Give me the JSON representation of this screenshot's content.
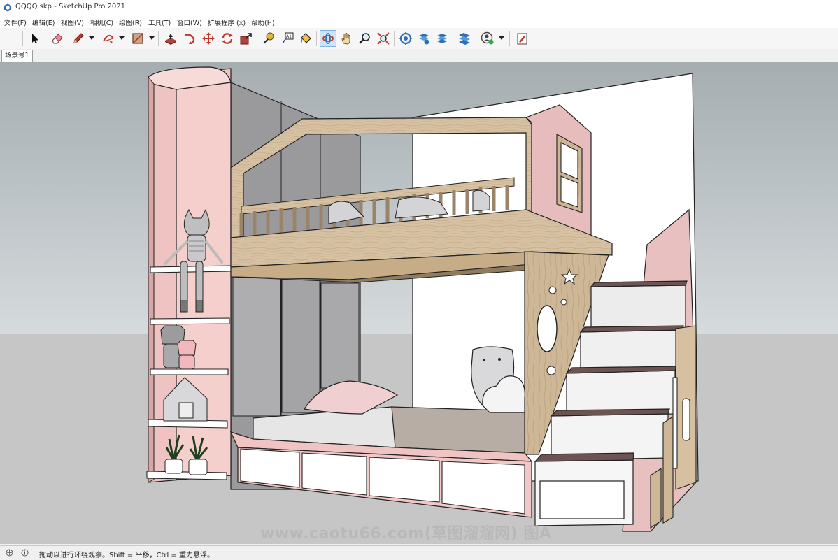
{
  "window": {
    "title": "QQQQ.skp - SketchUp Pro 2021"
  },
  "menu": [
    "文件(F)",
    "编辑(E)",
    "视图(V)",
    "相机(C)",
    "绘图(R)",
    "工具(T)",
    "窗口(W)",
    "扩展程序 (x)",
    "帮助(H)"
  ],
  "toolbar": {
    "buttons": [
      {
        "name": "select-tool-button",
        "icon": "arrow-cursor-icon"
      },
      {
        "name": "eraser-tool-button",
        "icon": "eraser-icon"
      },
      {
        "name": "line-tool-button",
        "icon": "pencil-icon"
      },
      {
        "name": "arc-tool-button",
        "icon": "arc-icon"
      },
      {
        "name": "rectangle-tool-button",
        "icon": "rectangle-icon"
      },
      {
        "name": "push-pull-tool-button",
        "icon": "push-pull-icon"
      },
      {
        "name": "follow-me-tool-button",
        "icon": "follow-me-icon"
      },
      {
        "name": "move-tool-button",
        "icon": "move-arrows-icon"
      },
      {
        "name": "rotate-tool-button",
        "icon": "rotate-icon"
      },
      {
        "name": "scale-tool-button",
        "icon": "scale-icon"
      },
      {
        "name": "tape-measure-tool-button",
        "icon": "tape-measure-icon"
      },
      {
        "name": "text-tool-button",
        "icon": "text-label-icon"
      },
      {
        "name": "paint-bucket-tool-button",
        "icon": "paint-bucket-icon"
      },
      {
        "name": "orbit-tool-button",
        "icon": "orbit-icon"
      },
      {
        "name": "pan-tool-button",
        "icon": "hand-icon"
      },
      {
        "name": "zoom-tool-button",
        "icon": "magnifier-icon"
      },
      {
        "name": "zoom-extents-tool-button",
        "icon": "zoom-extents-icon"
      },
      {
        "name": "warehouse-button",
        "icon": "warehouse-icon"
      },
      {
        "name": "share-model-button",
        "icon": "share-model-icon"
      },
      {
        "name": "extension-warehouse-button",
        "icon": "extension-warehouse-icon"
      },
      {
        "name": "layout-button",
        "icon": "layout-icon"
      },
      {
        "name": "profile-button",
        "icon": "user-profile-icon"
      },
      {
        "name": "report-button",
        "icon": "report-icon"
      }
    ]
  },
  "tabs": {
    "scene_tab": "场景号1"
  },
  "watermark": "www.caotu66.com(草图溜溜网) 图A",
  "status": {
    "text": "拖动以进行环绕观察。Shift = 平移，Ctrl = 重力悬浮。"
  },
  "colors": {
    "pink": "#f0c4c2",
    "pink_dark": "#d8a8a6",
    "wood": "#d8c3a5",
    "ground": "#c9c9c9",
    "sky": "#c6cccf",
    "wall_white": "#ffffff"
  }
}
